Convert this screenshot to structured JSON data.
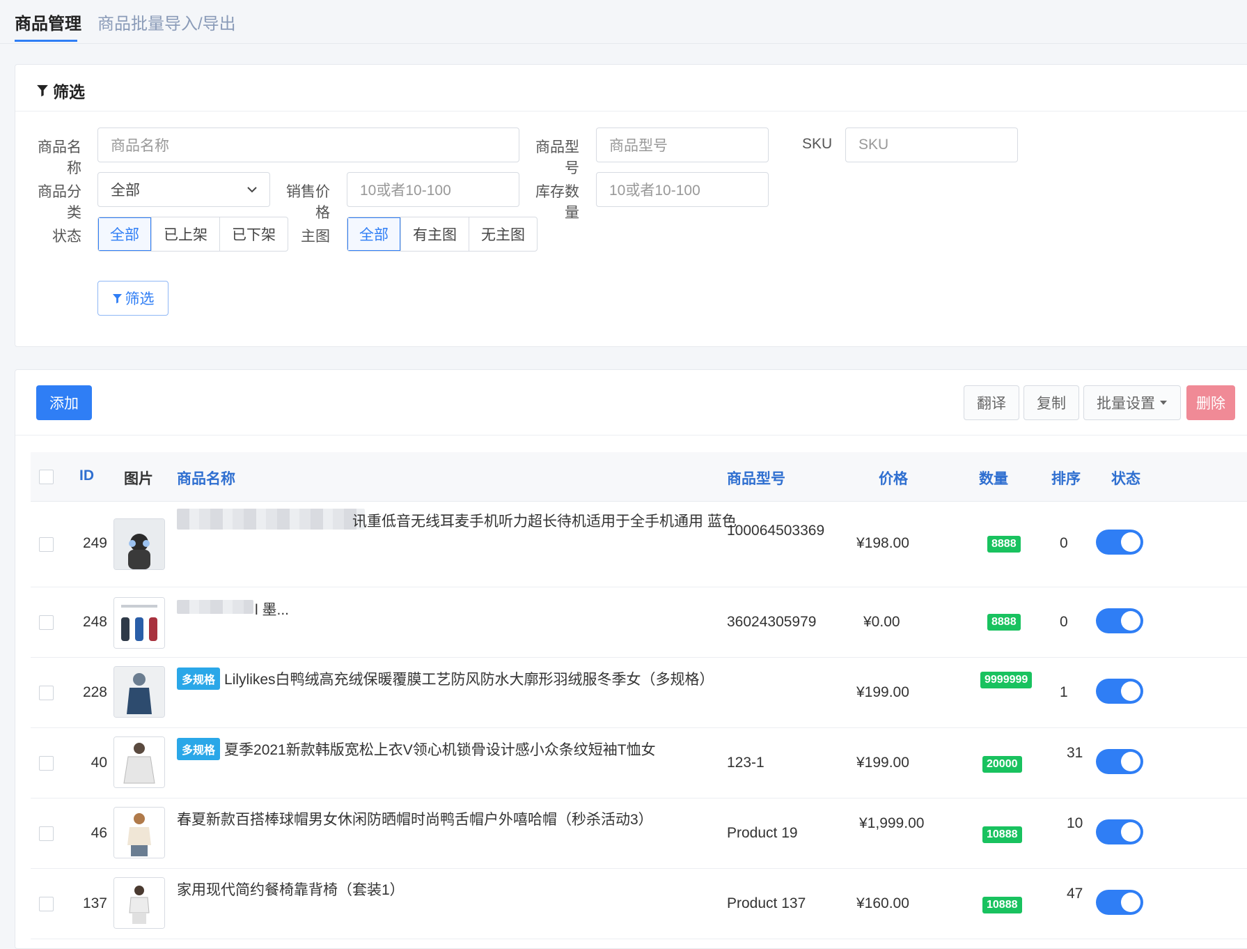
{
  "tabs": [
    {
      "label": "商品管理",
      "active": true
    },
    {
      "label": "商品批量导入/导出",
      "active": false
    }
  ],
  "filter": {
    "title": "筛选",
    "name_label": "商品名称",
    "name_placeholder": "商品名称",
    "model_label": "商品型号",
    "model_placeholder": "商品型号",
    "sku_label": "SKU",
    "sku_placeholder": "SKU",
    "category_label": "商品分类",
    "category_value": "全部",
    "price_label": "销售价格",
    "price_placeholder": "10或者10-100",
    "stock_label": "库存数量",
    "stock_placeholder": "10或者10-100",
    "status_label": "状态",
    "status_options": [
      "全部",
      "已上架",
      "已下架"
    ],
    "image_label": "主图",
    "image_options": [
      "全部",
      "有主图",
      "无主图"
    ],
    "submit_label": "筛选"
  },
  "toolbar": {
    "add": "添加",
    "translate": "翻译",
    "copy": "复制",
    "batch": "批量设置",
    "delete": "删除"
  },
  "table": {
    "headers": {
      "id": "ID",
      "image": "图片",
      "name": "商品名称",
      "model": "商品型号",
      "price": "价格",
      "qty": "数量",
      "sort": "排序",
      "status": "状态"
    },
    "multi_tag": "多规格",
    "rows": [
      {
        "id": "249",
        "name": "讯重低音无线耳麦手机听力超长待机适用于全手机通用 蓝色",
        "model": "100064503369",
        "price": "¥198.00",
        "qty": "8888",
        "sort": "0",
        "status_on": true
      },
      {
        "id": "248",
        "name": "l 墨...",
        "model": "36024305979",
        "price": "¥0.00",
        "qty": "8888",
        "sort": "0",
        "status_on": true
      },
      {
        "id": "228",
        "name": "Lilylikes白鸭绒高充绒保暖覆膜工艺防风防水大廓形羽绒服冬季女（多规格）",
        "model": "",
        "price": "¥199.00",
        "qty": "9999999",
        "sort": "1",
        "status_on": true,
        "multi": true
      },
      {
        "id": "40",
        "name": "夏季2021新款韩版宽松上衣V领心机锁骨设计感小众条纹短袖T恤女",
        "model": "123-1",
        "price": "¥199.00",
        "qty": "20000",
        "sort": "31",
        "status_on": true,
        "multi": true
      },
      {
        "id": "46",
        "name": "春夏新款百搭棒球帽男女休闲防晒帽时尚鸭舌帽户外嘻哈帽（秒杀活动3）",
        "model": "Product 19",
        "price": "¥1,999.00",
        "qty": "10888",
        "sort": "10",
        "status_on": true
      },
      {
        "id": "137",
        "name": "家用现代简约餐椅靠背椅（套装1）",
        "model": "Product 137",
        "price": "¥160.00",
        "qty": "10888",
        "sort": "47",
        "status_on": true
      }
    ]
  },
  "colors": {
    "primary": "#2f7ef5",
    "badge_green": "#19c25f",
    "tag_blue": "#2aa7e8",
    "danger": "#f08a96"
  }
}
